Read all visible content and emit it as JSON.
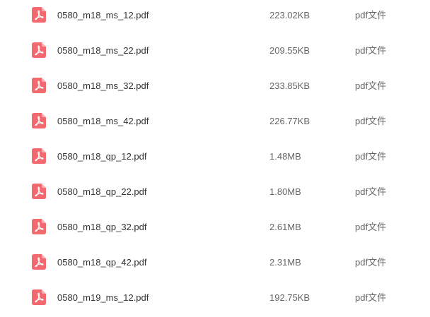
{
  "icon": "pdf-file-icon",
  "accent_color": "#f26a6f",
  "files": [
    {
      "name": "0580_m18_ms_12.pdf",
      "size": "223.02KB",
      "type": "pdf文件"
    },
    {
      "name": "0580_m18_ms_22.pdf",
      "size": "209.55KB",
      "type": "pdf文件"
    },
    {
      "name": "0580_m18_ms_32.pdf",
      "size": "233.85KB",
      "type": "pdf文件"
    },
    {
      "name": "0580_m18_ms_42.pdf",
      "size": "226.77KB",
      "type": "pdf文件"
    },
    {
      "name": "0580_m18_qp_12.pdf",
      "size": "1.48MB",
      "type": "pdf文件"
    },
    {
      "name": "0580_m18_qp_22.pdf",
      "size": "1.80MB",
      "type": "pdf文件"
    },
    {
      "name": "0580_m18_qp_32.pdf",
      "size": "2.61MB",
      "type": "pdf文件"
    },
    {
      "name": "0580_m18_qp_42.pdf",
      "size": "2.31MB",
      "type": "pdf文件"
    },
    {
      "name": "0580_m19_ms_12.pdf",
      "size": "192.75KB",
      "type": "pdf文件"
    }
  ]
}
